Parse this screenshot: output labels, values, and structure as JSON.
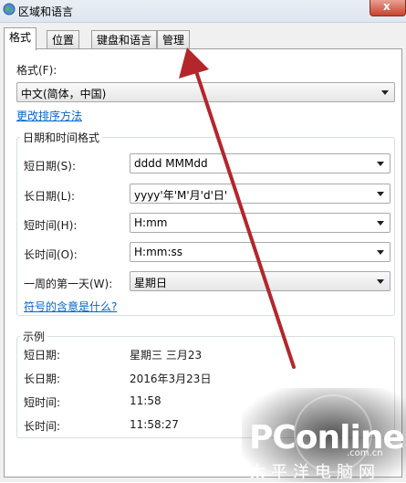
{
  "window": {
    "title": "区域和语言",
    "close_glyph": "x"
  },
  "tabs": [
    "格式",
    "位置",
    "键盘和语言",
    "管理"
  ],
  "format": {
    "label": "格式(F):",
    "value": "中文(简体，中国)",
    "sort_link": "更改排序方法"
  },
  "datetime": {
    "group_title": "日期和时间格式",
    "rows": [
      {
        "label": "短日期(S):",
        "value": "dddd  MMMdd"
      },
      {
        "label": "长日期(L):",
        "value": "yyyy'年'M'月'd'日'"
      },
      {
        "label": "短时间(H):",
        "value": "H:mm"
      },
      {
        "label": "长时间(O):",
        "value": "H:mm:ss"
      },
      {
        "label": "一周的第一天(W):",
        "value": "星期日"
      }
    ],
    "symbols_link": "符号的含意是什么?"
  },
  "examples": {
    "group_title": "示例",
    "rows": [
      {
        "label": "短日期:",
        "value": "星期三  三月23"
      },
      {
        "label": "长日期:",
        "value": "2016年3月23日"
      },
      {
        "label": "短时间:",
        "value": "11:58"
      },
      {
        "label": "长时间:",
        "value": "11:58:27"
      }
    ]
  },
  "watermark": {
    "logo_text": "PConline",
    "domain": ".com.cn",
    "chinese": "太平洋电脑网"
  },
  "colors": {
    "arrow": "#b3262b",
    "link": "#0066cc"
  },
  "icons": {
    "app": "globe-icon",
    "close": "close-icon",
    "dropdown": "chevron-down-icon",
    "annotation": "red-arrow-annotation"
  }
}
